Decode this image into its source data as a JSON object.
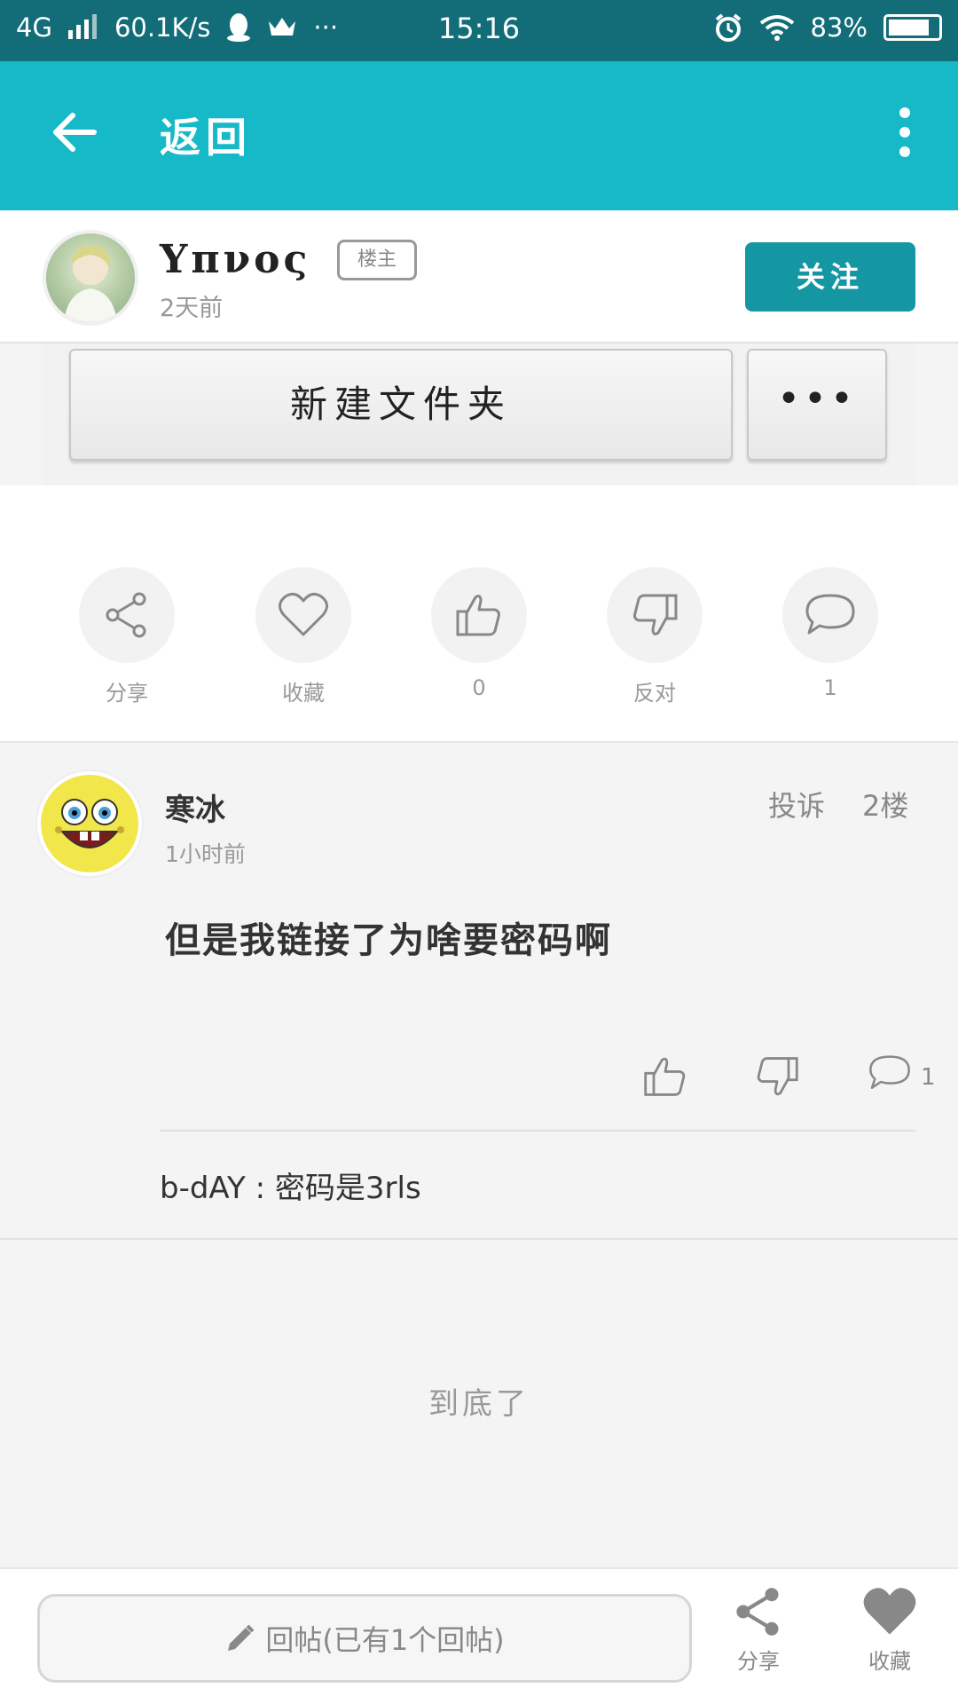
{
  "status_bar": {
    "network": "4G",
    "speed": "60.1K/s",
    "dots": "···",
    "time": "15:16",
    "battery": "83%",
    "battery_level": 0.83
  },
  "app_bar": {
    "title": "返回"
  },
  "post": {
    "author": "Υπνος",
    "badge": "楼主",
    "time": "2天前",
    "follow_label": "关注",
    "embedded_image": {
      "new_folder_label": "新建文件夹",
      "more_label": "•••"
    },
    "actions": [
      {
        "icon": "share-icon",
        "label": "分享"
      },
      {
        "icon": "heart-icon",
        "label": "收藏"
      },
      {
        "icon": "thumbs-up-icon",
        "label": "0"
      },
      {
        "icon": "thumbs-down-icon",
        "label": "反对"
      },
      {
        "icon": "comment-icon",
        "label": "1"
      }
    ]
  },
  "reply": {
    "author": "寒冰",
    "time": "1小时前",
    "report_label": "投诉",
    "floor": "2楼",
    "content": "但是我链接了为啥要密码啊",
    "comment_count": "1",
    "sub_reply": {
      "author": "b-dAY",
      "text": "密码是3rls"
    }
  },
  "end_text": "到底了",
  "bottom_bar": {
    "reply_placeholder": "回帖(已有1个回帖)",
    "share_label": "分享",
    "favorite_label": "收藏"
  },
  "colors": {
    "status_bar": "#126d78",
    "app_bar": "#16b9c8",
    "follow_button": "#1597a3"
  }
}
